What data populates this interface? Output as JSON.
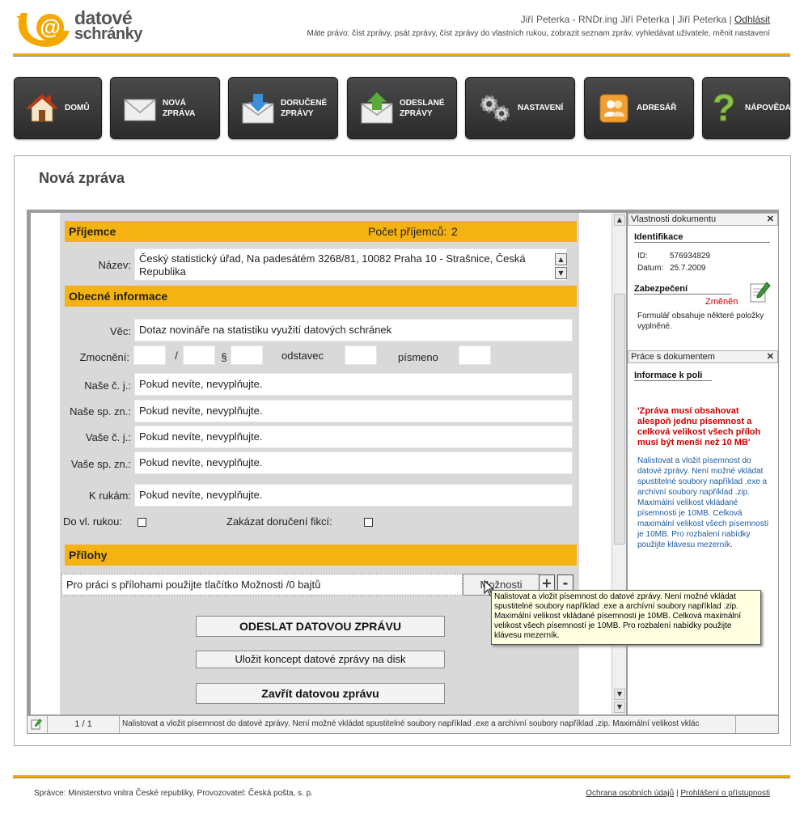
{
  "logo": {
    "line1": "datové",
    "line2": "schránky"
  },
  "header": {
    "user": "Jiří Peterka - RNDr.ing Jiří Peterka | Jiří Peterka |",
    "logout": "Odhlásit",
    "rights": "Máte právo: číst zprávy, psát zprávy, číst zprávy do vlastních rukou, zobrazit seznam zpráv, vyhledávat uživatele, měnit nastavení"
  },
  "nav": [
    {
      "label": "DOMŮ",
      "icon": "house-icon"
    },
    {
      "label": "NOVÁ\nZPRÁVA",
      "icon": "envelope-icon"
    },
    {
      "label": "DORUČENÉ\nZPRÁVY",
      "icon": "inbox-download-icon"
    },
    {
      "label": "ODESLANÉ\nZPRÁVY",
      "icon": "outbox-upload-icon"
    },
    {
      "label": "NASTAVENÍ",
      "icon": "gears-icon"
    },
    {
      "label": "ADRESÁŘ",
      "icon": "contacts-icon"
    },
    {
      "label": "NÁPOVĚDA",
      "icon": "question-icon"
    }
  ],
  "page": {
    "title": "Nová zpráva"
  },
  "form": {
    "recipient_header": "Příjemce",
    "recipient_count_label": "Počet příjemců:",
    "recipient_count": "2",
    "name_label": "Název:",
    "name_value_l1": "Český statistický úřad, Na padesátém 3268/81, 10082 Praha 10 - Strašnice, Česká",
    "name_value_l2": "Republika",
    "general_header": "Obecné informace",
    "subject_label": "Věc:",
    "subject_value": "Dotaz novináře na statistiku využití datových schránek",
    "authorization_label": "Zmocnění:",
    "slash": "/",
    "paragraph": "§",
    "odstavec": "odstavec",
    "pismeno": "písmeno",
    "placeholder": "Pokud nevíte, nevyplňujte.",
    "our_ref_label": "Naše č. j.:",
    "our_file_label": "Naše sp. zn.:",
    "your_ref_label": "Vaše č. j.:",
    "your_file_label": "Vaše sp. zn.:",
    "to_hands_label": "K rukám:",
    "personal_label": "Do vl. rukou:",
    "no_fiction_label": "Zakázat doručení fikcí:",
    "attachments_header": "Přílohy",
    "attachments_text": "Pro práci s přílohami použijte tlačítko Možnosti /0 bajtů",
    "options_button": "Možnosti",
    "plus": "+",
    "minus": "-",
    "send_button": "ODESLAT DATOVOU ZPRÁVU",
    "save_button": "Uložit koncept datové zprávy na disk",
    "close_button": "Zavřít datovou zprávu"
  },
  "tooltip": "Nalistovat a vložit písemnost do datové zprávy. Není možné vkládat spustitelné soubory například .exe a archívní soubory například .zip. Maximální velikost vkládané písemnosti je 10MB. Celková maximální velikost všech písemností je 10MB. Pro rozbalení nabídky použijte klávesu mezerník.",
  "side": {
    "props_title": "Vlastnosti dokumentu",
    "ident_title": "Identifikace",
    "id_label": "ID:",
    "id_value": "576934829",
    "date_label": "Datum:",
    "date_value": "25.7.2009",
    "security_title": "Zabezpečení",
    "changed": "Změněn",
    "filled_note": "Formulář obsahuje některé položky vyplněné.",
    "work_title": "Práce s dokumentem",
    "field_info_title": "Informace k poli",
    "warning": "'Zpráva musí obsahovat alespoň jednu písemnost a celková velikost všech příloh musí být menší než 10 MB'",
    "info": "Nalistovat a vložit písemnost do datové zprávy. Není možné vkládat spustitelné soubory například .exe a archívní soubory například .zip. Maximální velikost vkládané písemnosti je 10MB. Celková maximální velikost všech písemností je 10MB. Pro rozbalení nabídky použijte klávesu mezerník."
  },
  "statusbar": {
    "page": "1 / 1",
    "text": "Nalistovat a vložit písemnost do datové zprávy. Není možné vkládat spustitelné soubory například .exe a archívní soubory například .zip. Maximální velikost vklác"
  },
  "footer": {
    "left": "Správce: Ministerstvo vnitra České republiky, Provozovatel: Česká pošta, s. p.",
    "privacy": "Ochrana osobních údajů",
    "separator": "|",
    "accessibility": "Prohlášení o přístupnosti"
  },
  "colors": {
    "accent": "#f5b213",
    "nav_bg": "#333333",
    "warning": "#cc0000",
    "info": "#1a5c9e"
  }
}
